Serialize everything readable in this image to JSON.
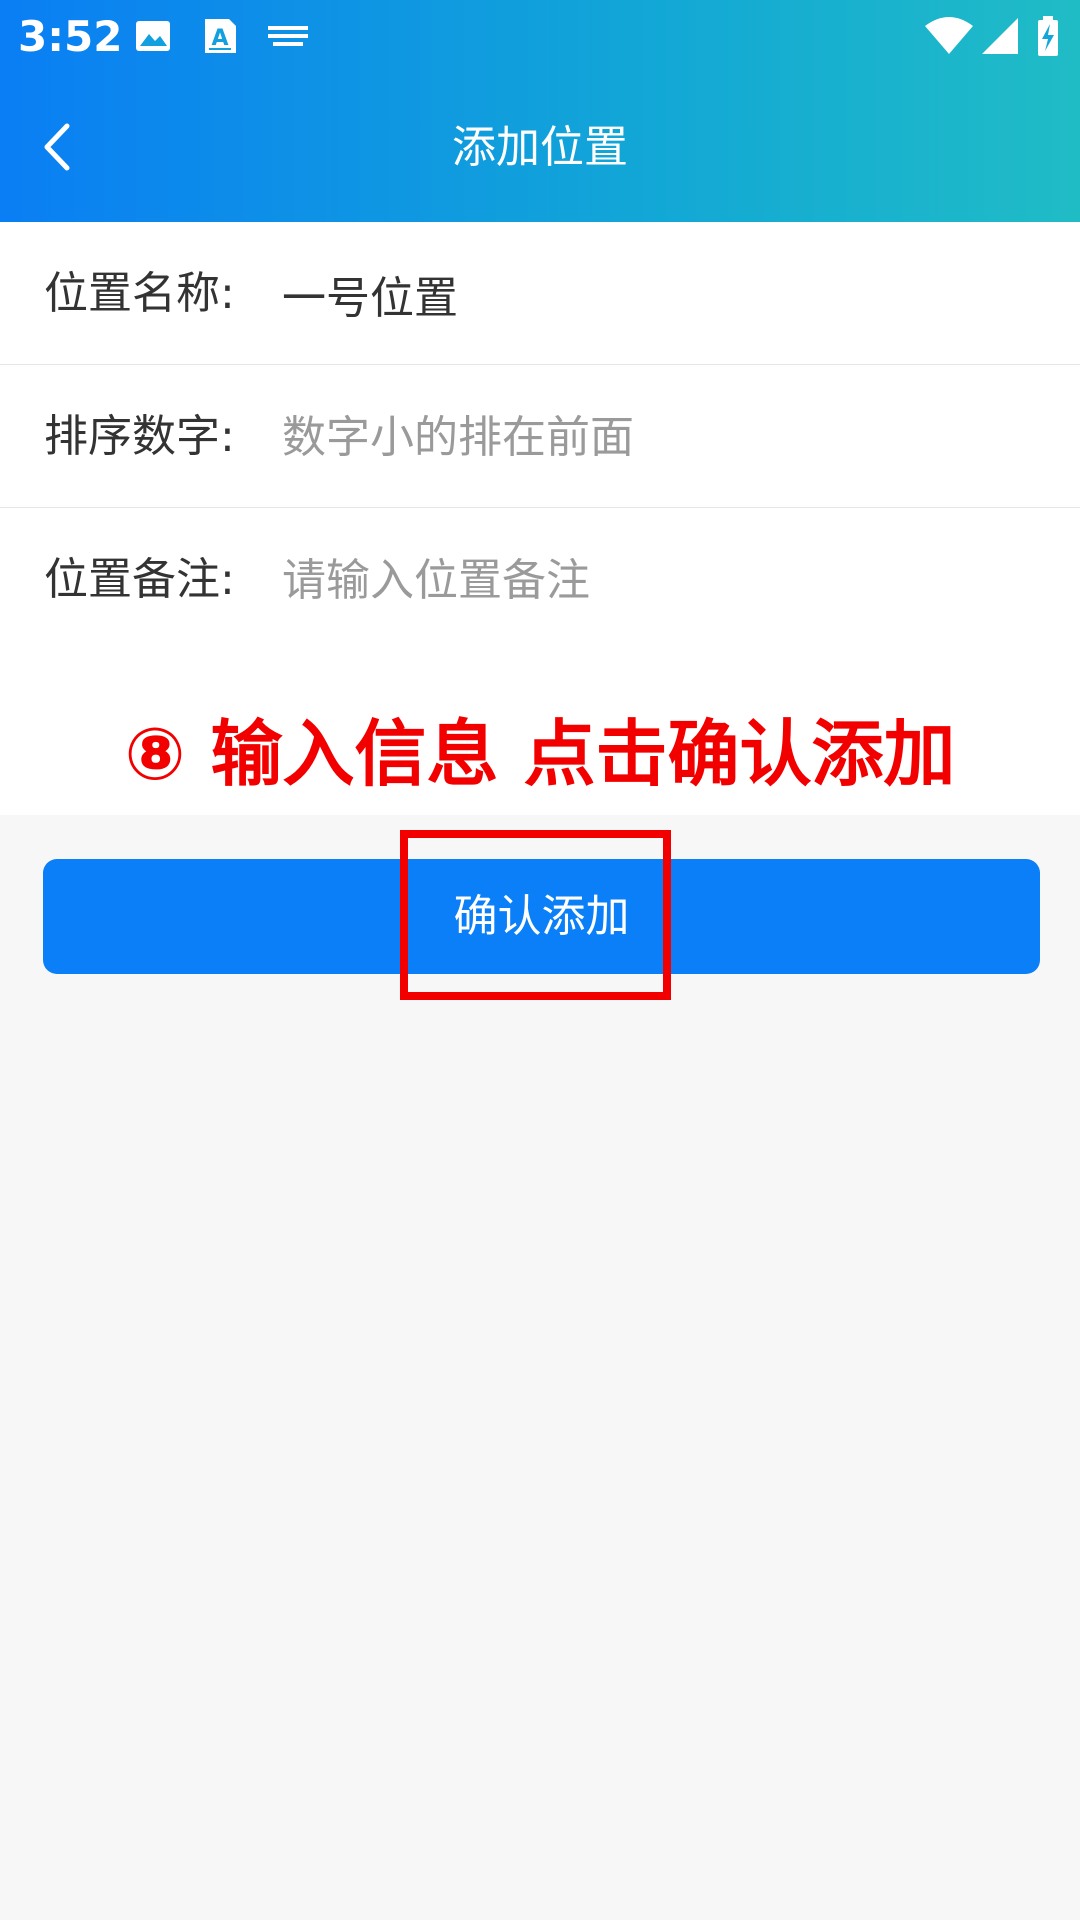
{
  "status_bar": {
    "time": "3:52",
    "icons": [
      "image-icon",
      "a-letter-icon",
      "keyboard-icon",
      "wifi-icon",
      "signal-icon",
      "battery-charging-icon"
    ]
  },
  "app_bar": {
    "title": "添加位置",
    "back_icon": "chevron-left-icon"
  },
  "form": {
    "fields": [
      {
        "label": "位置名称:",
        "value": "一号位置",
        "placeholder": ""
      },
      {
        "label": "排序数字:",
        "value": "",
        "placeholder": "数字小的排在前面"
      },
      {
        "label": "位置备注:",
        "value": "",
        "placeholder": "请输入位置备注"
      }
    ]
  },
  "annotation": {
    "text": "⑧ 输入信息 点击确认添加",
    "color": "#f20000"
  },
  "actions": {
    "confirm_label": "确认添加"
  },
  "colors": {
    "header_start": "#0a7ef4",
    "header_end": "#20bcc6",
    "button": "#0a7ff7",
    "background": "#f7f7f7"
  }
}
